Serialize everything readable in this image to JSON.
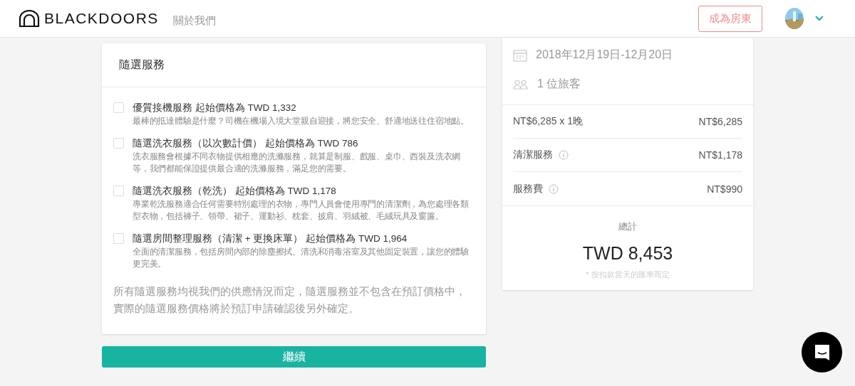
{
  "header": {
    "brand": "BLACKDOORS",
    "nav_link": "關於我們",
    "host_button": "成為房東"
  },
  "services": {
    "title": "隨選服務",
    "items": [
      {
        "title": "優質接機服務 起始價格為 TWD 1,332",
        "description": "最棒的抵達體驗是什麼？司機在機場入境大堂親自迎接，將您安全、舒適地送往住宿地點。",
        "checked": false
      },
      {
        "title": "隨選洗衣服務（以次數計價） 起始價格為 TWD 786",
        "description": "洗衣服務會根據不同衣物提供相應的洗滌服務，就算是制服、戲服、桌巾、西裝及洗衣網等，我們都能保證提供最合適的洗滌服務，滿足您的需要。",
        "checked": false
      },
      {
        "title": "隨選洗衣服務（乾洗） 起始價格為 TWD 1,178",
        "description": "專業乾洗服務適合任何需要特別處理的衣物，專門人員會使用專門的清潔劑，為您處理各類型衣物，包括褲子、領帶、裙子、運動衫、枕套、披肩、羽絨被、毛絨玩具及窗簾。",
        "checked": false
      },
      {
        "title": "隨選房間整理服務（清潔 + 更換床單） 起始價格為 TWD 1,964",
        "description": "全面的清潔服務，包括房間內部的除塵擦拭、清洗和消毒浴室及其他固定裝置，讓您的體驗更完美。",
        "checked": false
      }
    ],
    "note": "所有隨選服務均視我們的供應情況而定，隨選服務並不包含在預訂價格中，實際的隨選服務價格將於預訂申請確認後另外確定。",
    "continue_button": "繼續"
  },
  "summary": {
    "dates": "2018年12月19日-12月20日",
    "guests": "1 位旅客",
    "lines": [
      {
        "label": "NT$6,285 x 1晚",
        "amount": "NT$6,285",
        "info": false
      },
      {
        "label": "清潔服務",
        "amount": "NT$1,178",
        "info": true
      },
      {
        "label": "服務費",
        "amount": "NT$990",
        "info": true
      }
    ],
    "total_label": "總計",
    "total": "TWD 8,453",
    "total_note": "* 按扣款當天的匯率而定"
  }
}
